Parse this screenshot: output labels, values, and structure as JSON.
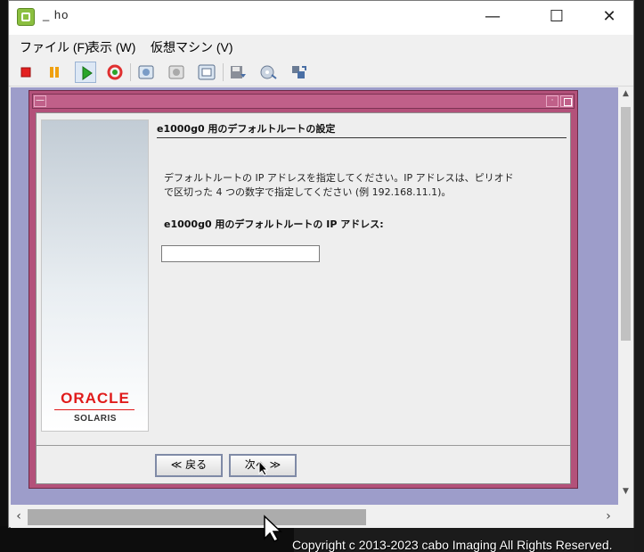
{
  "background": {
    "copyright": "Copyright c 2013-2023 cabo Imaging All Rights Reserved."
  },
  "window": {
    "title": "_ ho",
    "controls": {
      "minimize": "—",
      "maximize": "☐",
      "close": "✕"
    }
  },
  "menu": {
    "file": "ファイル (F)",
    "view": "表示 (W)",
    "vm": "仮想マシン (V)"
  },
  "toolbar": {
    "icons": [
      "stop-icon",
      "pause-icon",
      "play-icon",
      "reset-icon",
      "snapshot-icon",
      "revert-snapshot-icon",
      "snapshot-manager-icon",
      "connect-floppy-icon",
      "connect-cdrom-icon",
      "network-icon"
    ]
  },
  "installer": {
    "heading": "e1000g0 用のデフォルトルートの設定",
    "description_line1": "デフォルトルートの IP アドレスを指定してください。IP アドレスは、ピリオド",
    "description_line2": "で区切った 4 つの数字で指定してください (例 192.168.11.1)。",
    "field_label": "e1000g0 用のデフォルトルートの IP アドレス:",
    "ip_value": "",
    "logo_brand": "ORACLE",
    "logo_product": "SOLARIS",
    "back_label": "≪ 戻る",
    "next_label": "次へ ≫"
  },
  "colors": {
    "dialog_frame": "#b3517a",
    "console_bg": "#9d9dca",
    "oracle_red": "#e01b1b"
  }
}
